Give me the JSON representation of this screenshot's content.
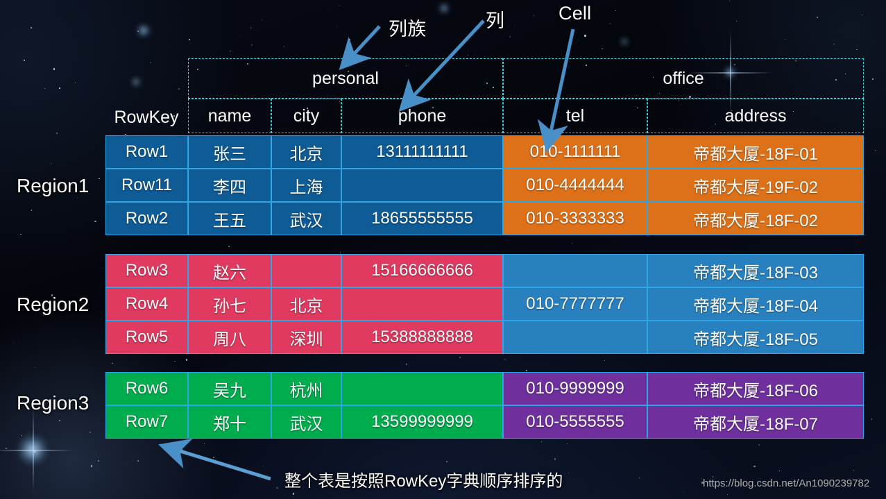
{
  "annotations": {
    "column_family": "列族",
    "column": "列",
    "cell": "Cell"
  },
  "table": {
    "rowkey_header": "RowKey",
    "column_families": [
      {
        "name": "personal",
        "columns": [
          "name",
          "city",
          "phone"
        ]
      },
      {
        "name": "office",
        "columns": [
          "tel",
          "address"
        ]
      }
    ],
    "columns": [
      "name",
      "city",
      "phone",
      "tel",
      "address"
    ]
  },
  "regions": [
    {
      "label": "Region1",
      "personal_color": "#0f5b96",
      "office_color": "#dd7119",
      "rows": [
        {
          "rowkey": "Row1",
          "name": "张三",
          "city": "北京",
          "phone": "13111111111",
          "tel": "010-1111111",
          "address": "帝都大厦-18F-01"
        },
        {
          "rowkey": "Row11",
          "name": "李四",
          "city": "上海",
          "phone": "",
          "tel": "010-4444444",
          "address": "帝都大厦-19F-02"
        },
        {
          "rowkey": "Row2",
          "name": "王五",
          "city": "武汉",
          "phone": "18655555555",
          "tel": "010-3333333",
          "address": "帝都大厦-18F-02"
        }
      ]
    },
    {
      "label": "Region2",
      "personal_color": "#e03a60",
      "office_color": "#2980bf",
      "rows": [
        {
          "rowkey": "Row3",
          "name": "赵六",
          "city": "",
          "phone": "15166666666",
          "tel": "",
          "address": "帝都大厦-18F-03"
        },
        {
          "rowkey": "Row4",
          "name": "孙七",
          "city": "北京",
          "phone": "",
          "tel": "010-7777777",
          "address": "帝都大厦-18F-04"
        },
        {
          "rowkey": "Row5",
          "name": "周八",
          "city": "深圳",
          "phone": "15388888888",
          "tel": "",
          "address": "帝都大厦-18F-05"
        }
      ]
    },
    {
      "label": "Region3",
      "personal_color": "#00ad4e",
      "office_color": "#6f309e",
      "rows": [
        {
          "rowkey": "Row6",
          "name": "吴九",
          "city": "杭州",
          "phone": "",
          "tel": "010-9999999",
          "address": "帝都大厦-18F-06"
        },
        {
          "rowkey": "Row7",
          "name": "郑十",
          "city": "武汉",
          "phone": "13599999999",
          "tel": "010-5555555",
          "address": "帝都大厦-18F-07"
        }
      ]
    }
  ],
  "caption": "整个表是按照RowKey字典顺序排序的",
  "watermark": "https://blog.csdn.net/An1090239782",
  "colors": {
    "arrow": "#4a90c8",
    "grid_dashed": "#3fd0d8",
    "cell_border": "#2ea6e6",
    "background": "#05070f"
  }
}
